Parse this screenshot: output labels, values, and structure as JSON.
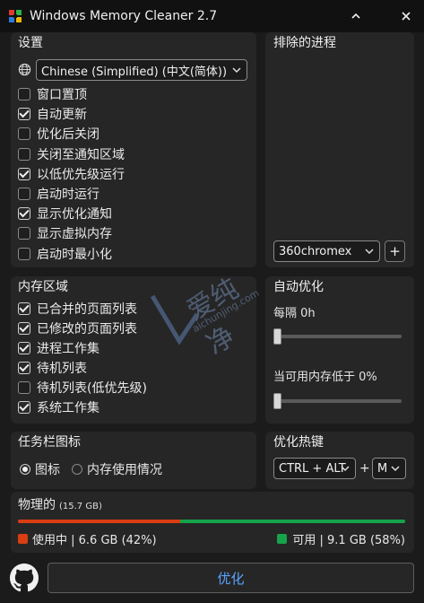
{
  "window": {
    "title": "Windows Memory Cleaner 2.7"
  },
  "settings": {
    "title": "设置",
    "language": "Chinese (Simplified) (中文(简体))",
    "options": [
      {
        "label": "窗口置顶",
        "checked": false
      },
      {
        "label": "自动更新",
        "checked": true
      },
      {
        "label": "优化后关闭",
        "checked": false
      },
      {
        "label": "关闭至通知区域",
        "checked": false
      },
      {
        "label": "以低优先级运行",
        "checked": true
      },
      {
        "label": "启动时运行",
        "checked": false
      },
      {
        "label": "显示优化通知",
        "checked": true
      },
      {
        "label": "显示虚拟内存",
        "checked": false
      },
      {
        "label": "启动时最小化",
        "checked": false
      }
    ]
  },
  "excluded": {
    "title": "排除的进程",
    "process_select": "360chromex",
    "add_label": "+"
  },
  "memory_areas": {
    "title": "内存区域",
    "options": [
      {
        "label": "已合并的页面列表",
        "checked": true
      },
      {
        "label": "已修改的页面列表",
        "checked": true
      },
      {
        "label": "进程工作集",
        "checked": true
      },
      {
        "label": "待机列表",
        "checked": true
      },
      {
        "label": "待机列表(低优先级)",
        "checked": false
      },
      {
        "label": "系统工作集",
        "checked": true
      }
    ]
  },
  "auto_optimize": {
    "title": "自动优化",
    "interval_label": "每隔 0h",
    "interval_value": 0,
    "threshold_label": "当可用内存低于 0%",
    "threshold_value": 0
  },
  "tray_icon": {
    "title": "任务栏图标",
    "options": [
      {
        "label": "图标",
        "selected": true
      },
      {
        "label": "内存使用情况",
        "selected": false
      }
    ]
  },
  "hotkey": {
    "title": "优化热键",
    "modifier": "CTRL + ALT",
    "plus": "+",
    "key": "M"
  },
  "physical": {
    "title": "物理的",
    "total": "(15.7 GB)",
    "used_fraction": 0.42,
    "used_label": "使用中 | 6.6 GB (42%)",
    "free_label": "可用 | 9.1 GB (58%)",
    "used_color": "#d93d12",
    "free_color": "#16a34a"
  },
  "footer": {
    "optimize_label": "优化"
  },
  "watermark": {
    "text1": "爱纯净",
    "text2": "aichunjing.com"
  }
}
